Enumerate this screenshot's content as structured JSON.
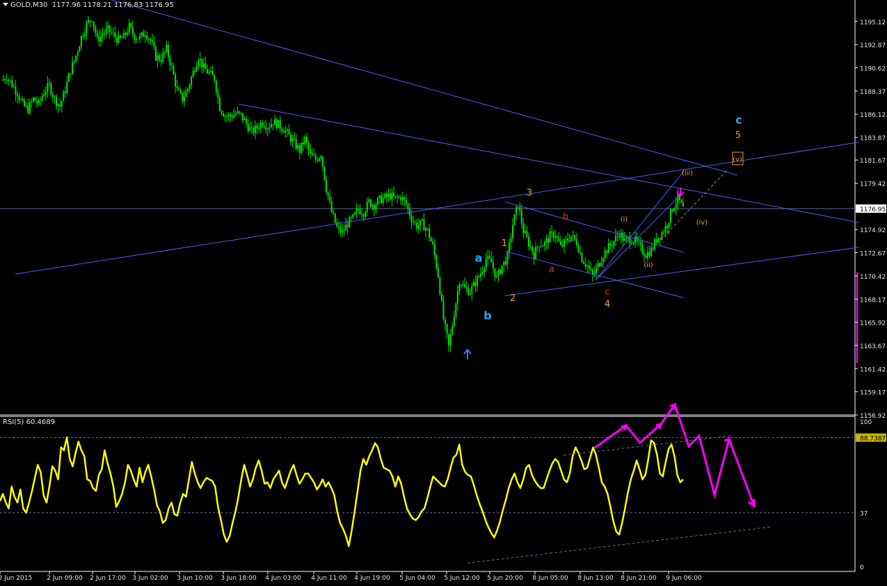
{
  "header": {
    "symbol": "GOLD,M30",
    "ohlc": "1177.96 1178.21 1176.83 1176.95",
    "rsi_label": "RSI(5) 60.4689"
  },
  "colors": {
    "background": "#000000",
    "candle": "#00e600",
    "trendline": "#4a5cff",
    "rsi": "#ffff00",
    "projection": "#ff00ff",
    "wave_cyan": "#22aaff",
    "wave_orange": "#f0a020",
    "wave_red": "#e03010",
    "current_price_bg": "#ffffff",
    "rsi_level_bg": "#c8b400"
  },
  "chart_data": [
    {
      "type": "candlestick",
      "symbol": "GOLD",
      "timeframe": "M30",
      "y_ticks": [
        1195.12,
        1192.87,
        1190.62,
        1188.37,
        1186.12,
        1183.87,
        1181.67,
        1179.42,
        1176.95,
        1174.92,
        1172.67,
        1170.42,
        1168.17,
        1165.92,
        1163.67,
        1161.42,
        1159.17,
        1156.92
      ],
      "ylim": [
        1156.92,
        1197.0
      ],
      "current_price": 1176.95,
      "x_ticks": [
        "2 Jun 2015",
        "2 Jun 09:00",
        "2 Jun 17:00",
        "3 Jun 02:00",
        "3 Jun 10:00",
        "3 Jun 18:00",
        "4 Jun 03:00",
        "4 Jun 11:00",
        "4 Jun 19:00",
        "5 Jun 04:00",
        "5 Jun 12:00",
        "5 Jun 20:00",
        "8 Jun 05:00",
        "8 Jun 13:00",
        "8 Jun 21:00",
        "9 Jun 06:00"
      ],
      "close_path": [
        1189.4,
        1189.8,
        1189.0,
        1188.2,
        1187.0,
        1186.6,
        1187.6,
        1187.1,
        1188.3,
        1188.9,
        1187.6,
        1186.9,
        1188.5,
        1190.4,
        1191.8,
        1193.6,
        1194.8,
        1195.5,
        1193.3,
        1193.9,
        1194.3,
        1193.8,
        1193.3,
        1193.6,
        1194.6,
        1193.7,
        1193.5,
        1194.1,
        1193.3,
        1191.7,
        1191.5,
        1192.4,
        1190.6,
        1188.4,
        1187.6,
        1188.6,
        1190.2,
        1191.7,
        1190.6,
        1190.1,
        1189.6,
        1186.8,
        1186.0,
        1185.9,
        1186.2,
        1186.0,
        1185.2,
        1184.4,
        1184.8,
        1185.4,
        1184.9,
        1185.4,
        1185.1,
        1184.7,
        1184.0,
        1183.3,
        1182.6,
        1183.7,
        1182.1,
        1181.7,
        1182.3,
        1178.9,
        1176.6,
        1175.1,
        1174.6,
        1175.5,
        1176.0,
        1176.9,
        1176.6,
        1177.6,
        1177.3,
        1177.8,
        1178.0,
        1178.2,
        1177.9,
        1178.1,
        1177.4,
        1176.0,
        1175.3,
        1175.5,
        1174.8,
        1173.3,
        1170.5,
        1166.2,
        1163.5,
        1166.8,
        1170.0,
        1169.2,
        1168.9,
        1169.8,
        1170.7,
        1172.1,
        1171.7,
        1170.2,
        1171.4,
        1172.2,
        1175.4,
        1177.4,
        1174.8,
        1173.6,
        1172.5,
        1173.6,
        1173.5,
        1174.3,
        1174.5,
        1173.2,
        1173.8,
        1174.3,
        1173.7,
        1172.1,
        1171.4,
        1170.4,
        1171.4,
        1172.5,
        1173.2,
        1173.8,
        1174.6,
        1173.8,
        1174.0,
        1173.8,
        1173.1,
        1172.5,
        1172.9,
        1174.0,
        1174.6,
        1175.4,
        1177.0,
        1177.9,
        1176.95
      ],
      "trendlines": [
        {
          "from": [
            "2 Jun 17:00",
            1197.3
          ],
          "to": [
            "9 Jun 06:00+",
            1180.2
          ]
        },
        {
          "from": [
            "3 Jun 18:00",
            1187.1
          ],
          "to": [
            "9 Jun 06:00++",
            1175.6
          ]
        },
        {
          "from": [
            "2 Jun 2015",
            1170.6
          ],
          "to": [
            "9 Jun 06:00++",
            1183.4
          ]
        },
        {
          "from": [
            "5 Jun 20:00",
            1168.5
          ],
          "to": [
            "9 Jun 06:00++",
            1173.2
          ]
        },
        {
          "from": [
            "5 Jun 20:00",
            1172.8
          ],
          "to": [
            "9 Jun 06:00",
            1168.3
          ]
        },
        {
          "from": [
            "5 Jun 20:00",
            1177.6
          ],
          "to": [
            "9 Jun 06:00",
            1172.7
          ]
        },
        {
          "from": [
            "8 Jun 13:00",
            1170.0
          ],
          "to": [
            "9 Jun 06:00",
            1180.6
          ]
        },
        {
          "from": [
            "8 Jun 13:00",
            1170.0
          ],
          "to": [
            "9 Jun 06:00",
            1178.6
          ]
        }
      ],
      "wave_labels": [
        {
          "text": "a",
          "color": "#22aaff",
          "at": [
            1171.8,
            "5 Jun 12:00"
          ]
        },
        {
          "text": "b",
          "color": "#22aaff",
          "at": [
            1166.2,
            "5 Jun 12:00"
          ]
        },
        {
          "text": "c",
          "color": "#22aaff",
          "at": [
            1185.2,
            "9 Jun 06:00+"
          ]
        },
        {
          "text": "1",
          "color": "#f0a020",
          "at": [
            1173.3,
            "5 Jun 20:00"
          ]
        },
        {
          "text": "2",
          "color": "#f0a020",
          "at": [
            1168.0,
            "5 Jun 20:00"
          ]
        },
        {
          "text": "3",
          "color": "#f0a020",
          "at": [
            1178.2,
            "8 Jun 05:00"
          ]
        },
        {
          "text": "4",
          "color": "#f0a020",
          "at": [
            1167.4,
            "8 Jun 13:00"
          ]
        },
        {
          "text": "5",
          "color": "#f0a020",
          "at": [
            1183.8,
            "9 Jun 06:00+"
          ]
        },
        {
          "text": "(i)",
          "color": "#f0a020",
          "at": [
            1175.7,
            "8 Jun 21:00"
          ]
        },
        {
          "text": "(ii)",
          "color": "#f0a020",
          "at": [
            1171.3,
            "8 Jun 21:00"
          ]
        },
        {
          "text": "(iii)",
          "color": "#f0a020",
          "at": [
            1180.2,
            "9 Jun 06:00"
          ]
        },
        {
          "text": "(iv)",
          "color": "#f0a020",
          "at": [
            1175.4,
            "9 Jun 06:00"
          ]
        },
        {
          "text": "(v)",
          "color": "#f0a020",
          "at": [
            1181.5,
            "9 Jun 06:00+"
          ]
        },
        {
          "text": "a",
          "color": "#e03010",
          "at": [
            1170.8,
            "8 Jun 05:00"
          ]
        },
        {
          "text": "b",
          "color": "#e03010",
          "at": [
            1175.9,
            "8 Jun 05:00"
          ]
        },
        {
          "text": "c",
          "color": "#e03010",
          "at": [
            1168.6,
            "8 Jun 13:00"
          ]
        }
      ]
    },
    {
      "type": "line",
      "indicator": "RSI(5)",
      "value": 60.4689,
      "ylim": [
        0,
        100
      ],
      "y_ticks": [
        100,
        37,
        0
      ],
      "levels": [
        88.7387,
        37
      ],
      "level_labels": [
        "88.7387",
        "37"
      ],
      "series": [
        {
          "values": [
            45,
            50,
            44,
            40,
            55,
            48,
            44,
            53,
            40,
            37,
            44,
            52,
            61,
            70,
            65,
            49,
            44,
            55,
            69,
            66,
            60,
            82,
            80,
            89,
            74,
            69,
            78,
            86,
            80,
            76,
            60,
            59,
            54,
            52,
            63,
            67,
            80,
            71,
            64,
            55,
            41,
            45,
            50,
            58,
            70,
            66,
            60,
            55,
            68,
            58,
            65,
            70,
            62,
            53,
            42,
            38,
            30,
            32,
            40,
            44,
            36,
            35,
            44,
            50,
            48,
            60,
            72,
            64,
            58,
            54,
            58,
            61,
            60,
            59,
            55,
            41,
            32,
            22,
            17,
            21,
            30,
            38,
            48,
            60,
            70,
            63,
            55,
            60,
            68,
            73,
            66,
            57,
            58,
            54,
            60,
            63,
            66,
            58,
            54,
            60,
            66,
            70,
            63,
            57,
            60,
            64,
            64,
            61,
            58,
            53,
            56,
            60,
            55,
            58,
            54,
            49,
            38,
            30,
            26,
            21,
            14,
            25,
            38,
            52,
            66,
            74,
            70,
            76,
            80,
            85,
            82,
            74,
            68,
            67,
            66,
            62,
            55,
            62,
            57,
            48,
            40,
            36,
            33,
            32,
            34,
            38,
            40,
            47,
            55,
            62,
            60,
            58,
            56,
            55,
            60,
            68,
            75,
            77,
            84,
            70,
            65,
            63,
            62,
            56,
            49,
            43,
            38,
            32,
            27,
            23,
            20,
            25,
            31,
            39,
            46,
            54,
            60,
            64,
            58,
            54,
            60,
            68,
            70,
            63,
            59,
            56,
            54,
            54,
            60,
            66,
            71,
            74,
            72,
            66,
            60,
            58,
            64,
            76,
            82,
            78,
            73,
            67,
            68,
            75,
            82,
            77,
            68,
            58,
            55,
            50,
            41,
            31,
            24,
            22,
            30,
            40,
            51,
            60,
            66,
            73,
            67,
            60,
            63,
            74,
            87,
            85,
            77,
            64,
            62,
            72,
            81,
            84,
            76,
            63,
            58,
            60
          ]
        }
      ]
    }
  ]
}
